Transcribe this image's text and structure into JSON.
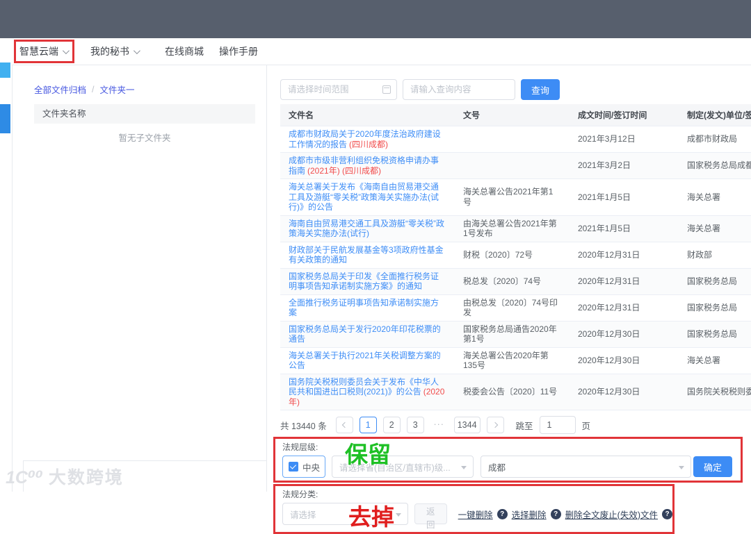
{
  "nav": {
    "items": [
      {
        "label": "智慧云端"
      },
      {
        "label": "我的秘书"
      },
      {
        "label": "在线商城"
      },
      {
        "label": "操作手册"
      }
    ]
  },
  "side": {
    "breadcrumb_root": "全部文件归档",
    "breadcrumb_sep": "/",
    "breadcrumb_current": "文件夹一",
    "folder_header": "文件夹名称",
    "empty_text": "暂无子文件夹"
  },
  "search": {
    "date_placeholder": "请选择时间范围",
    "query_placeholder": "请输入查询内容",
    "submit_label": "查询"
  },
  "table": {
    "headers": [
      "文件名",
      "文号",
      "成文时间/签订时间",
      "制定(发文)单位/签订国"
    ],
    "rows": [
      {
        "title": "成都市财政局关于2020年度法治政府建设工作情况的报告",
        "red": "(四川成都)",
        "no": "",
        "date": "2021年3月12日",
        "unit": "成都市财政局"
      },
      {
        "title": "成都市市级非营利组织免税资格申请办事指南",
        "red": "(2021年) (四川成都)",
        "no": "",
        "date": "2021年3月2日",
        "unit": "国家税务总局成都市税"
      },
      {
        "title": "海关总署关于发布《海南自由贸易港交通工具及游艇“零关税”政策海关实施办法(试行)》的公告",
        "no": "海关总署公告2021年第1号",
        "date": "2021年1月5日",
        "unit": "海关总署"
      },
      {
        "title": "海南自由贸易港交通工具及游艇“零关税”政策海关实施办法(试行)",
        "no": "由海关总署公告2021年第1号发布",
        "date": "2021年1月5日",
        "unit": "海关总署"
      },
      {
        "title": "财政部关于民航发展基金等3项政府性基金有关政策的通知",
        "no": "财税〔2020〕72号",
        "date": "2020年12月31日",
        "unit": "财政部"
      },
      {
        "title": "国家税务总局关于印发《全面推行税务证明事项告知承诺制实施方案》的通知",
        "no": "税总发〔2020〕74号",
        "date": "2020年12月31日",
        "unit": "国家税务总局"
      },
      {
        "title": "全面推行税务证明事项告知承诺制实施方案",
        "no": "由税总发〔2020〕74号印发",
        "date": "2020年12月31日",
        "unit": "国家税务总局"
      },
      {
        "title": "国家税务总局关于发行2020年印花税票的通告",
        "no": "国家税务总局通告2020年第1号",
        "date": "2020年12月30日",
        "unit": "国家税务总局"
      },
      {
        "title": "海关总署关于执行2021年关税调整方案的公告",
        "no": "海关总署公告2020年第135号",
        "date": "2020年12月30日",
        "unit": "海关总署"
      },
      {
        "title": "国务院关税税则委员会关于发布《中华人民共和国进出口税则(2021)》的公告",
        "red": "(2020年)",
        "no": "税委会公告〔2020〕11号",
        "date": "2020年12月30日",
        "unit": "国务院关税税则委员会"
      }
    ]
  },
  "pagination": {
    "total": "共 13440 条",
    "pages": [
      "1",
      "2",
      "3",
      "···",
      "1344"
    ],
    "jump_label": "跳至",
    "jump_value": "1",
    "page_unit": "页"
  },
  "filters": {
    "level_label": "法规层级:",
    "central_label": "中央",
    "province_placeholder": "请选择省(自治区/直辖市)级...",
    "city_value": "成都",
    "confirm_label": "确定",
    "category_label": "法规分类:",
    "category_placeholder": "请选择",
    "back_label": "返回",
    "links": [
      {
        "label": "一键删除"
      },
      {
        "label": "选择删除"
      },
      {
        "label": "删除全文废止(失效)文件"
      }
    ],
    "help_glyph": "?"
  },
  "annotations": {
    "keep": "保留",
    "remove": "去掉"
  },
  "watermark": {
    "logo": "1C⁰⁰",
    "name": "大数跨境"
  }
}
